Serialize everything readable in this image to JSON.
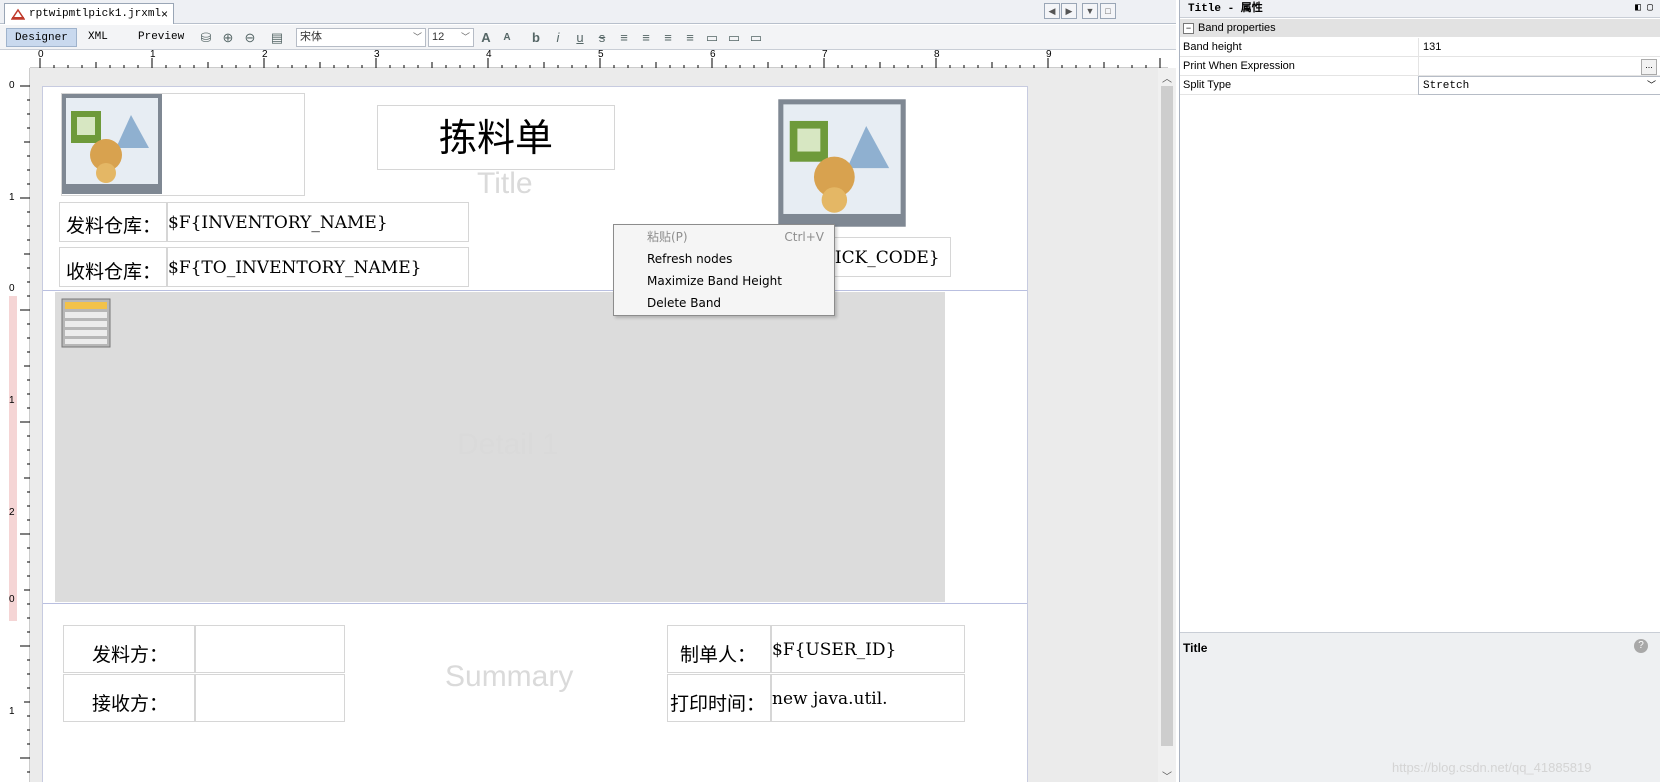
{
  "tab": {
    "filename": "rptwipmtlpick1.jrxml",
    "close": "×"
  },
  "views": [
    "Designer",
    "XML",
    "Preview"
  ],
  "toolbar": {
    "font": "宋体",
    "size": "12",
    "bold": "b",
    "italic": "i",
    "underline": "u",
    "strike": "s"
  },
  "ruler": {
    "h": [
      "0",
      "1",
      "2",
      "3",
      "4",
      "5",
      "6",
      "7",
      "8",
      "9"
    ],
    "v": [
      "0",
      "1",
      "0",
      "1",
      "2",
      "0",
      "1"
    ]
  },
  "report": {
    "title": "拣料单",
    "bands": {
      "title": "Title",
      "detail": "Detail 1",
      "summary": "Summary"
    },
    "label_from_wh": "发料仓库：",
    "value_from_wh": "$F{INVENTORY_NAME}",
    "label_to_wh": "收料仓库：",
    "value_to_wh": "$F{TO_INVENTORY_NAME}",
    "value_pick_code": "$F{PICK_CODE}",
    "label_sender": "发料方：",
    "label_receiver": "接收方：",
    "label_maker": "制单人：",
    "value_maker": "$F{USER_ID}",
    "label_print_time": "打印时间：",
    "value_print_time": "new java.util."
  },
  "context_menu": [
    {
      "label": "粘贴(P)",
      "shortcut": "Ctrl+V",
      "enabled": false
    },
    {
      "label": "Refresh nodes",
      "shortcut": "",
      "enabled": true
    },
    {
      "label": "Maximize Band Height",
      "shortcut": "",
      "enabled": true
    },
    {
      "label": "Delete Band",
      "shortcut": "",
      "enabled": true
    }
  ],
  "properties": {
    "header": "Title - 属性",
    "section": "Band properties",
    "rows": [
      {
        "key": "Band height",
        "value": "131"
      },
      {
        "key": "Print When Expression",
        "value": ""
      },
      {
        "key": "Split Type",
        "value": "Stretch"
      }
    ],
    "description_title": "Title",
    "more_button": "..."
  },
  "watermark": "https://blog.csdn.net/qq_41885819"
}
